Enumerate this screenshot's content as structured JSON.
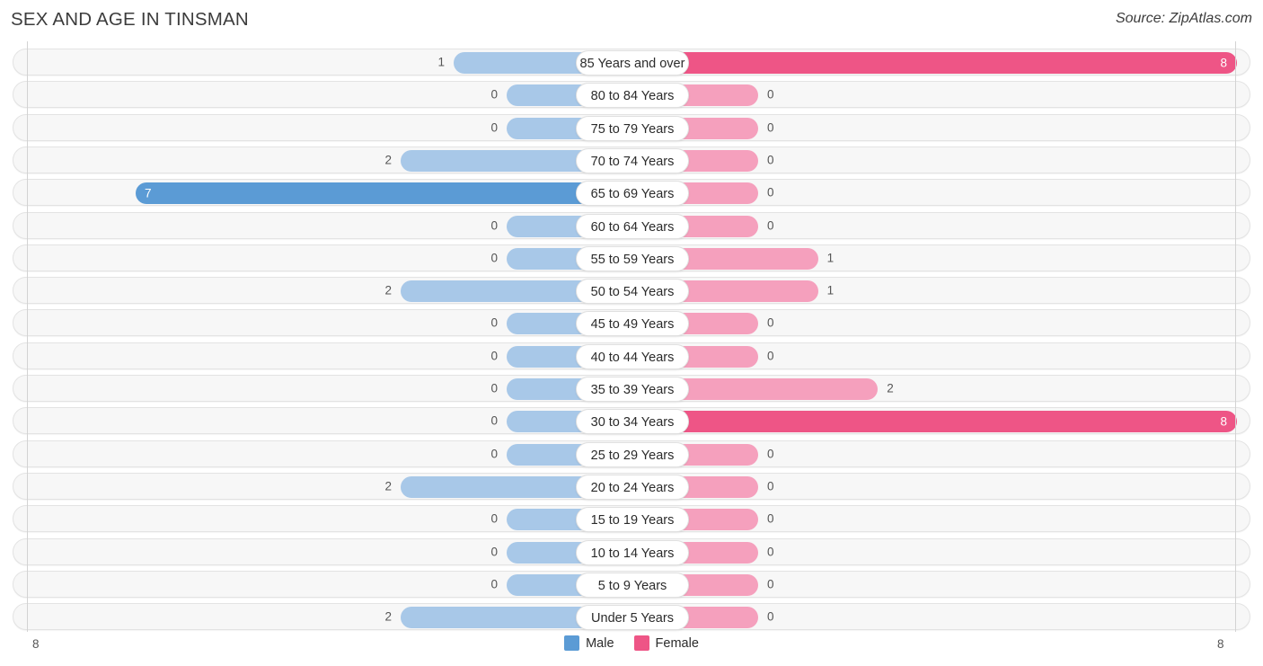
{
  "header": {
    "title": "SEX AND AGE IN TINSMAN",
    "source": "Source: ZipAtlas.com"
  },
  "legend": {
    "male_label": "Male",
    "female_label": "Female",
    "male_color": "#5b9bd5",
    "female_color": "#ee5586"
  },
  "axis": {
    "left_tick": "8",
    "right_tick": "8",
    "max": 8
  },
  "colors": {
    "male_light": "#a8c8e8",
    "male_strong": "#5b9bd5",
    "female_light": "#f5a0bd",
    "female_strong": "#ee5586",
    "row_bg": "#f7f7f7",
    "row_border": "#e3e3e3"
  },
  "chart_data": {
    "type": "bar",
    "title": "SEX AND AGE IN TINSMAN",
    "subtitle": "Source: ZipAtlas.com",
    "orientation": "horizontal-diverging",
    "xlabel": "",
    "ylabel": "",
    "xlim": [
      8,
      8
    ],
    "grid": false,
    "legend_position": "bottom-center",
    "categories": [
      "85 Years and over",
      "80 to 84 Years",
      "75 to 79 Years",
      "70 to 74 Years",
      "65 to 69 Years",
      "60 to 64 Years",
      "55 to 59 Years",
      "50 to 54 Years",
      "45 to 49 Years",
      "40 to 44 Years",
      "35 to 39 Years",
      "30 to 34 Years",
      "25 to 29 Years",
      "20 to 24 Years",
      "15 to 19 Years",
      "10 to 14 Years",
      "5 to 9 Years",
      "Under 5 Years"
    ],
    "series": [
      {
        "name": "Male",
        "color": "#5b9bd5",
        "values": [
          1,
          0,
          0,
          2,
          7,
          0,
          0,
          2,
          0,
          0,
          0,
          0,
          0,
          2,
          0,
          0,
          0,
          2
        ]
      },
      {
        "name": "Female",
        "color": "#ee5586",
        "values": [
          8,
          0,
          0,
          0,
          0,
          0,
          1,
          1,
          0,
          0,
          2,
          8,
          0,
          0,
          0,
          0,
          0,
          0
        ]
      }
    ]
  },
  "rows": [
    {
      "label": "85 Years and over",
      "male": "1",
      "female": "8"
    },
    {
      "label": "80 to 84 Years",
      "male": "0",
      "female": "0"
    },
    {
      "label": "75 to 79 Years",
      "male": "0",
      "female": "0"
    },
    {
      "label": "70 to 74 Years",
      "male": "2",
      "female": "0"
    },
    {
      "label": "65 to 69 Years",
      "male": "7",
      "female": "0"
    },
    {
      "label": "60 to 64 Years",
      "male": "0",
      "female": "0"
    },
    {
      "label": "55 to 59 Years",
      "male": "0",
      "female": "1"
    },
    {
      "label": "50 to 54 Years",
      "male": "2",
      "female": "1"
    },
    {
      "label": "45 to 49 Years",
      "male": "0",
      "female": "0"
    },
    {
      "label": "40 to 44 Years",
      "male": "0",
      "female": "0"
    },
    {
      "label": "35 to 39 Years",
      "male": "0",
      "female": "2"
    },
    {
      "label": "30 to 34 Years",
      "male": "0",
      "female": "8"
    },
    {
      "label": "25 to 29 Years",
      "male": "0",
      "female": "0"
    },
    {
      "label": "20 to 24 Years",
      "male": "2",
      "female": "0"
    },
    {
      "label": "15 to 19 Years",
      "male": "0",
      "female": "0"
    },
    {
      "label": "10 to 14 Years",
      "male": "0",
      "female": "0"
    },
    {
      "label": "5 to 9 Years",
      "male": "0",
      "female": "0"
    },
    {
      "label": "Under 5 Years",
      "male": "2",
      "female": "0"
    }
  ]
}
